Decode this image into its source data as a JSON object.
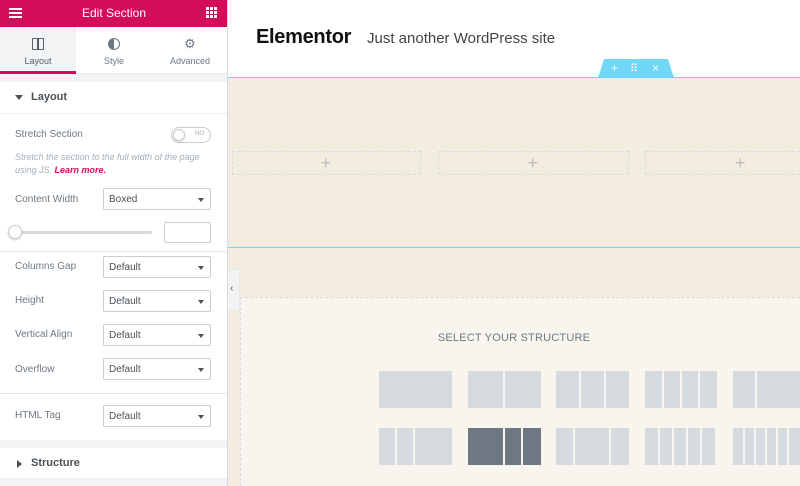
{
  "panel": {
    "title": "Edit Section",
    "tabs": [
      {
        "label": "Layout",
        "icon": "layout-icon"
      },
      {
        "label": "Style",
        "icon": "style-icon"
      },
      {
        "label": "Advanced",
        "icon": "gear-icon"
      }
    ],
    "layout_section": {
      "title": "Layout",
      "stretch": {
        "label": "Stretch Section",
        "toggle": "NO",
        "description": "Stretch the section to the full width of the page using JS.",
        "learn_more": "Learn more."
      },
      "content_width": {
        "label": "Content Width",
        "value": "Boxed"
      },
      "columns_gap": {
        "label": "Columns Gap",
        "value": "Default"
      },
      "height": {
        "label": "Height",
        "value": "Default"
      },
      "vertical_align": {
        "label": "Vertical Align",
        "value": "Default"
      },
      "overflow": {
        "label": "Overflow",
        "value": "Default"
      },
      "html_tag": {
        "label": "HTML Tag",
        "value": "Default"
      }
    },
    "structure_section": {
      "title": "Structure"
    }
  },
  "preview": {
    "site_title": "Elementor",
    "tagline": "Just another WordPress site",
    "handle_icons": [
      "+",
      "⠿",
      "×"
    ],
    "column_plus": "+",
    "collapse_icon": "‹",
    "structure_title": "SELECT YOUR STRUCTURE"
  },
  "colors": {
    "accent": "#d30c5c",
    "section_outline": "#71d7f7",
    "section_bg": "#f3ede0"
  }
}
